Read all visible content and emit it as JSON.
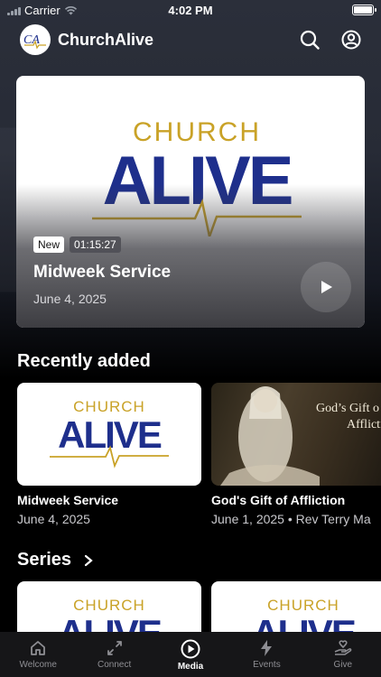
{
  "status_bar": {
    "carrier": "Carrier",
    "time": "4:02 PM"
  },
  "header": {
    "app_name": "ChurchAlive",
    "logo_text": "CA"
  },
  "brand": {
    "line1": "CHURCH",
    "line2": "ALIVE",
    "blue": "#1e2f8c",
    "gold": "#c9a227"
  },
  "hero": {
    "badge": "New",
    "duration": "01:15:27",
    "title": "Midweek Service",
    "date": "June 4, 2025"
  },
  "recently_added": {
    "title": "Recently added",
    "items": [
      {
        "title": "Midweek Service",
        "subtitle": "June 4, 2025"
      },
      {
        "title": "God's Gift of Affliction",
        "subtitle": "June 1, 2025 • Rev Terry Ma",
        "artwork_text_line1": "God’s Gift o",
        "artwork_text_line2": "Afflictio"
      }
    ]
  },
  "series": {
    "title": "Series"
  },
  "tabs": [
    {
      "label": "Welcome",
      "icon": "home-icon"
    },
    {
      "label": "Connect",
      "icon": "arrows-icon"
    },
    {
      "label": "Media",
      "icon": "play-circle-icon",
      "active": true
    },
    {
      "label": "Events",
      "icon": "lightning-icon"
    },
    {
      "label": "Give",
      "icon": "give-hand-icon"
    }
  ]
}
